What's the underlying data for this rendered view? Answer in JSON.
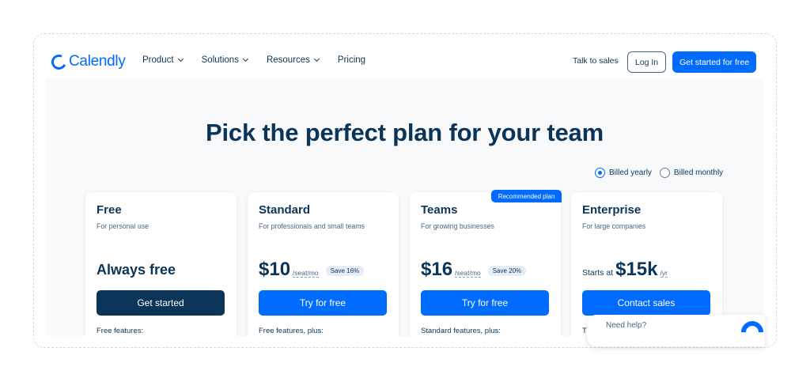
{
  "nav": {
    "logo": "Calendly",
    "menu": [
      "Product",
      "Solutions",
      "Resources",
      "Pricing"
    ],
    "talk_to_sales": "Talk to sales",
    "login": "Log In",
    "get_started": "Get started for free"
  },
  "hero": {
    "title": "Pick the perfect plan for your team"
  },
  "billing": {
    "yearly": "Billed yearly",
    "monthly": "Billed monthly",
    "selected": "yearly"
  },
  "recommended_badge": "Recommended plan",
  "plans": [
    {
      "name": "Free",
      "subtitle": "For personal use",
      "price_text": "Always free",
      "cta": "Get started",
      "features_label": "Free features:"
    },
    {
      "name": "Standard",
      "subtitle": "For professionals and small teams",
      "price": "$10",
      "unit": "/seat/mo",
      "save": "Save 16%",
      "cta": "Try for free",
      "features_label": "Free features, plus:"
    },
    {
      "name": "Teams",
      "subtitle": "For growing businesses",
      "price": "$16",
      "unit": "/seat/mo",
      "save": "Save 20%",
      "cta": "Try for free",
      "features_label": "Standard features, plus:"
    },
    {
      "name": "Enterprise",
      "subtitle": "For large companies",
      "price_prefix": "Starts at",
      "price": "$15k",
      "unit": "/yr",
      "cta": "Contact sales",
      "features_label": "T"
    }
  ],
  "help_widget": {
    "text": "Need help?"
  },
  "colors": {
    "accent": "#006bff",
    "navy": "#0b3558",
    "muted": "#476788",
    "background": "#f8f9fb"
  }
}
